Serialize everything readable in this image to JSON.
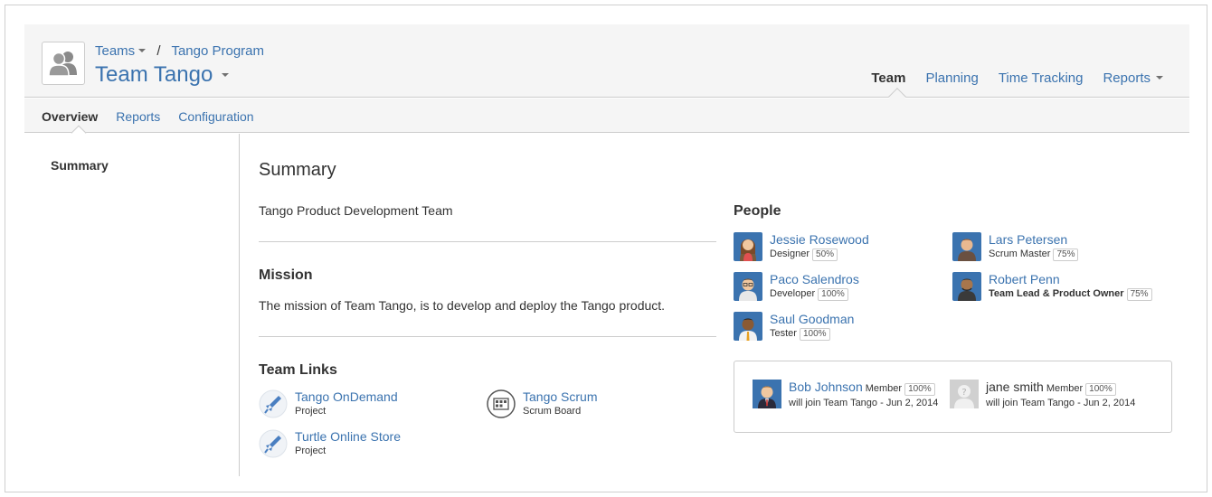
{
  "header": {
    "breadcrumb": {
      "parent": "Teams",
      "current": "Tango Program"
    },
    "title": "Team Tango",
    "nav": [
      "Team",
      "Planning",
      "Time Tracking",
      "Reports"
    ]
  },
  "subnav": [
    "Overview",
    "Reports",
    "Configuration"
  ],
  "sidebar": {
    "items": [
      "Summary"
    ]
  },
  "main": {
    "title": "Summary",
    "description": "Tango Product Development Team",
    "mission": {
      "heading": "Mission",
      "text": "The mission of Team Tango, is to develop and deploy the Tango product."
    },
    "links": {
      "heading": "Team Links",
      "items": [
        {
          "name": "Tango OnDemand",
          "type": "Project",
          "icon": "rocket-icon"
        },
        {
          "name": "Tango Scrum",
          "type": "Scrum Board",
          "icon": "board-icon"
        },
        {
          "name": "Turtle Online Store",
          "type": "Project",
          "icon": "rocket-icon"
        }
      ]
    }
  },
  "people": {
    "heading": "People",
    "members": [
      {
        "name": "Jessie Rosewood",
        "role": "Designer",
        "allocation": "50%"
      },
      {
        "name": "Lars Petersen",
        "role": "Scrum Master",
        "allocation": "75%"
      },
      {
        "name": "Paco Salendros",
        "role": "Developer",
        "allocation": "100%"
      },
      {
        "name": "Robert Penn",
        "role": "Team Lead & Product Owner",
        "allocation": "75%"
      },
      {
        "name": "Saul Goodman",
        "role": "Tester",
        "allocation": "100%"
      }
    ],
    "joining": [
      {
        "name": "Bob Johnson",
        "role": "Member",
        "allocation": "100%",
        "note": "will join Team Tango - Jun 2, 2014"
      },
      {
        "name": "jane smith",
        "role": "Member",
        "allocation": "100%",
        "note": "will join Team Tango - Jun 2, 2014"
      }
    ]
  },
  "colors": {
    "link": "#3b73af",
    "header_bg": "#f5f5f5",
    "border": "#cccccc"
  }
}
